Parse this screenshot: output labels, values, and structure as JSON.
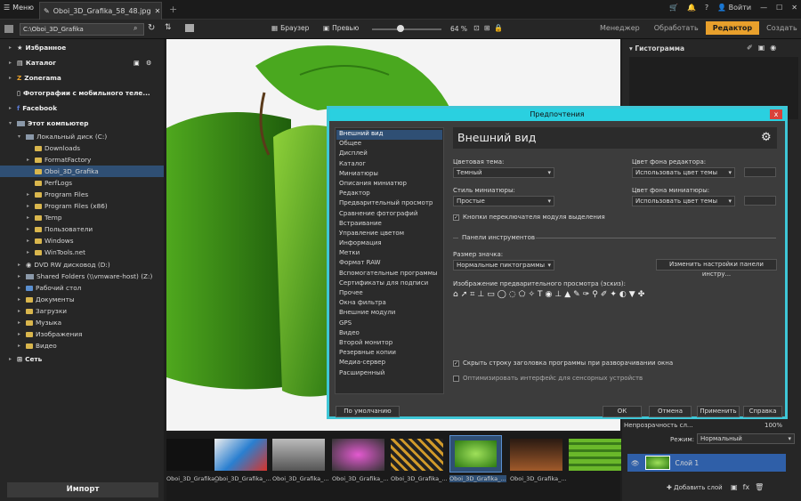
{
  "topbar": {
    "menu": "Меню",
    "doc_tab": "Oboi_3D_Grafika_58_48.jpg",
    "login": "Войти"
  },
  "toolbar": {
    "path": "C:\\Oboi_3D_Grafika",
    "browser": "Браузер",
    "preview": "Превью",
    "zoom": "64 %"
  },
  "modes": {
    "manager": "Менеджер",
    "process": "Обработать",
    "editor": "Редактор",
    "create": "Создать"
  },
  "sidebar": {
    "items": [
      "Избранное",
      "Каталог",
      "Zonerama",
      "Фотографии с мобильного теле...",
      "Facebook",
      "Этот компьютер",
      "Локальный диск (C:)",
      "Downloads",
      "FormatFactory",
      "Oboi_3D_Grafika",
      "PerfLogs",
      "Program Files",
      "Program Files (x86)",
      "Temp",
      "Пользователи",
      "Windows",
      "WinTools.net",
      "DVD RW дисковод (D:)",
      "Shared Folders (\\\\vmware-host) (Z:)",
      "Рабочий стол",
      "Документы",
      "Загрузки",
      "Музыка",
      "Изображения",
      "Видео",
      "Сеть"
    ],
    "import": "Импорт"
  },
  "filmstrip": {
    "labels": [
      "Oboi_3D_Grafika_...",
      "Oboi_3D_Grafika_...",
      "Oboi_3D_Grafika_...",
      "Oboi_3D_Grafika_...",
      "Oboi_3D_Grafika_...",
      "Oboi_3D_Grafika_...",
      "Oboi_3D_Grafika_..."
    ]
  },
  "right": {
    "histogram": "Гистограмма",
    "opacity": "Непрозрачность сл...",
    "opacity_val": "100%",
    "mode_label": "Режим:",
    "mode_val": "Нормальный",
    "layer": "Слой 1",
    "add_layer": "Добавить слой"
  },
  "dialog": {
    "title": "Предпочтения",
    "close": "x",
    "list": [
      "Внешний вид",
      "Общее",
      "Дисплей",
      "Каталог",
      "Миниатюры",
      "Описания миниатюр",
      "Редактор",
      "Предварительный просмотр",
      "Сравнение фотографий",
      "Встраивание",
      "Управление цветом",
      "Информация",
      "Метки",
      "Формат RAW",
      "Вспомогательные программы",
      "Сертификаты для подписи",
      "Прочее",
      "Окна фильтра",
      "Внешние модули",
      "GPS",
      "Видео",
      "Второй монитор",
      "Резервные копии",
      "Медиа-сервер",
      "Расширенный"
    ],
    "header": "Внешний вид",
    "color_theme_label": "Цветовая тема:",
    "color_theme": "Темный",
    "editor_bg_label": "Цвет фона редактора:",
    "editor_bg": "Использовать цвет темы",
    "thumb_style_label": "Стиль миниатюры:",
    "thumb_style": "Простые",
    "thumb_bg_label": "Цвет фона миниатюры:",
    "thumb_bg": "Использовать цвет темы",
    "module_buttons": "Кнопки переключателя модуля выделения",
    "toolbars": "Панели инструментов",
    "icon_size_label": "Размер значка:",
    "icon_size": "Нормальные пиктограммы",
    "change_toolbar": "Изменить настройки панели инстру...",
    "preview_icons_label": "Изображение предварительного просмотра (эскиз):",
    "hide_title": "Скрыть строку заголовка программы при разворачивании окна",
    "touch": "Оптимизировать интерфейс для сенсорных устройств",
    "default": "По умолчанию",
    "ok": "ОК",
    "cancel": "Отмена",
    "apply": "Применить",
    "help": "Справка"
  },
  "colors": {
    "accent": "#e8a02c",
    "dialog_border": "#3ec6d6",
    "selection": "#2f4f74"
  }
}
